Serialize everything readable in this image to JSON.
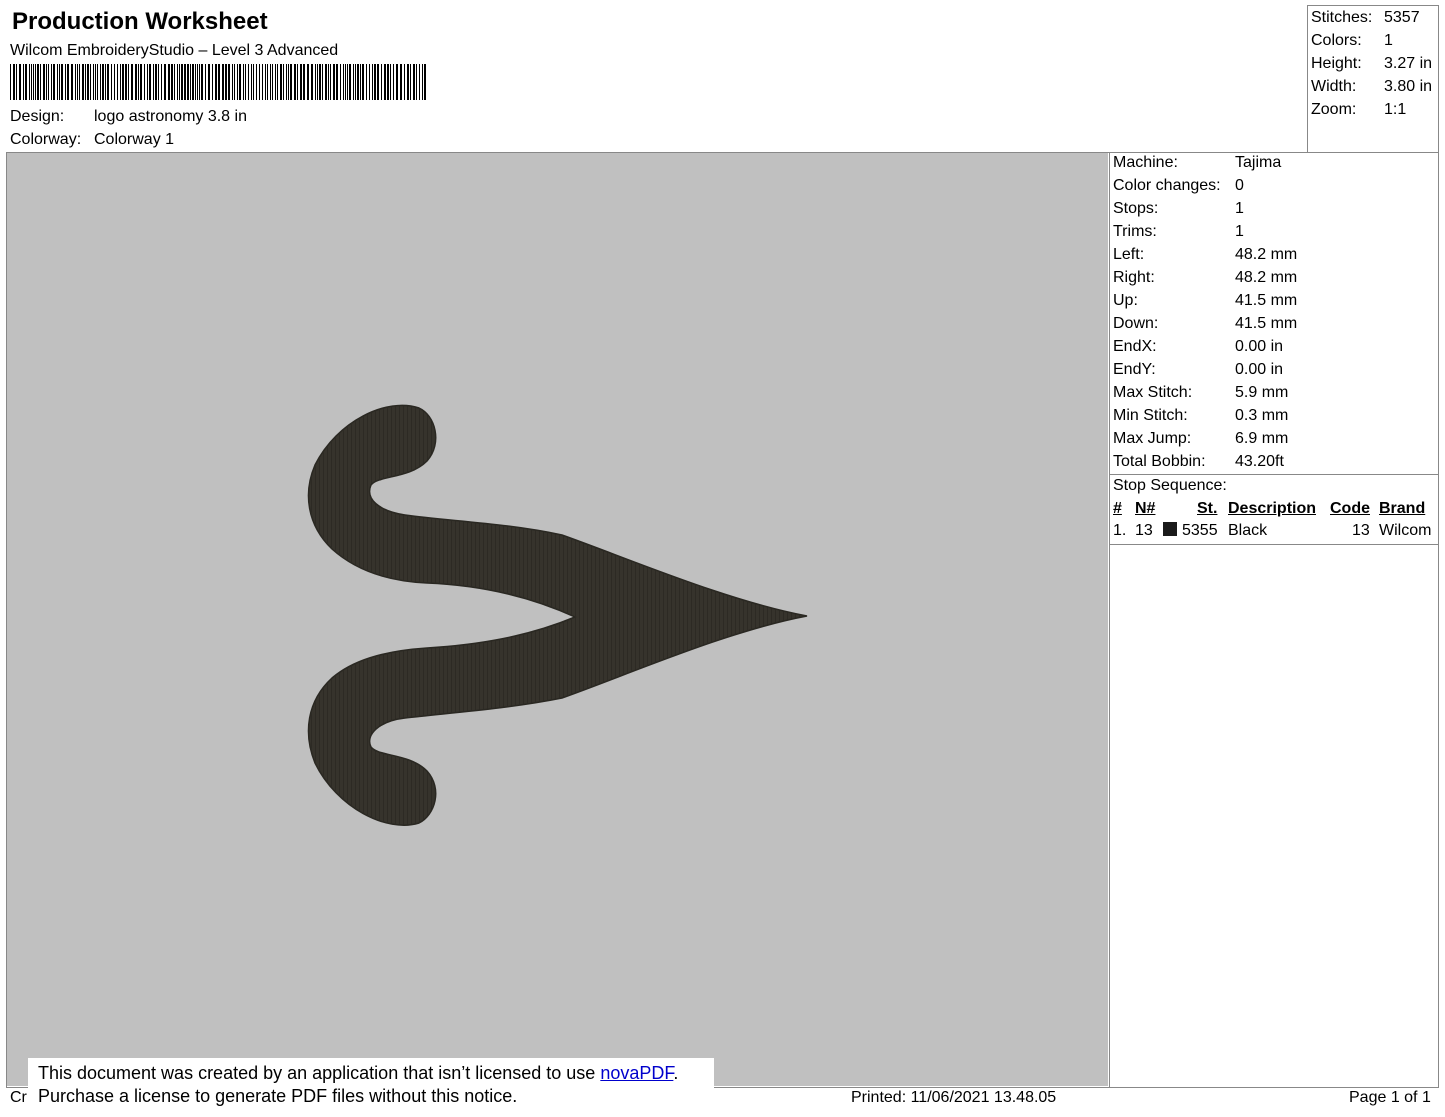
{
  "header": {
    "title": "Production Worksheet",
    "software": "Wilcom EmbroideryStudio – Level 3 Advanced",
    "design_label": "Design:",
    "design_value": "logo astronomy 3.8 in",
    "colorway_label": "Colorway:",
    "colorway_value": "Colorway 1"
  },
  "summary": {
    "stitches_label": "Stitches:",
    "stitches_value": "5357",
    "colors_label": "Colors:",
    "colors_value": "1",
    "height_label": "Height:",
    "height_value": "3.27 in",
    "width_label": "Width:",
    "width_value": "3.80 in",
    "zoom_label": "Zoom:",
    "zoom_value": "1:1"
  },
  "details": [
    {
      "label": "Machine:",
      "value": "Tajima"
    },
    {
      "label": "Color changes:",
      "value": "0"
    },
    {
      "label": "Stops:",
      "value": "1"
    },
    {
      "label": "Trims:",
      "value": "1"
    },
    {
      "label": "Left:",
      "value": "48.2 mm"
    },
    {
      "label": "Right:",
      "value": "48.2 mm"
    },
    {
      "label": "Up:",
      "value": "41.5 mm"
    },
    {
      "label": "Down:",
      "value": "41.5 mm"
    },
    {
      "label": "EndX:",
      "value": "0.00 in"
    },
    {
      "label": "EndY:",
      "value": "0.00 in"
    },
    {
      "label": "Max Stitch:",
      "value": "5.9 mm"
    },
    {
      "label": "Min Stitch:",
      "value": "0.3 mm"
    },
    {
      "label": "Max Jump:",
      "value": "6.9 mm"
    },
    {
      "label": "Total Bobbin:",
      "value": "43.20ft"
    }
  ],
  "stop_sequence": {
    "title": "Stop Sequence:",
    "headers": {
      "num": "#",
      "n": "N#",
      "st": "St.",
      "description": "Description",
      "code": "Code",
      "brand": "Brand"
    },
    "rows": [
      {
        "num": "1.",
        "n": "13",
        "swatch_color": "#1a1a1a",
        "st": "5355",
        "description": "Black",
        "code": "13",
        "brand": "Wilcom"
      }
    ]
  },
  "design": {
    "background_color": "#c0c0c0",
    "thread_color": "#36332c"
  },
  "notice": {
    "line1_prefix": "This document was created by an application that isn’t licensed to use ",
    "line1_link": "novaPDF",
    "line1_suffix": ".",
    "line2": "Purchase a license to generate PDF files without this notice."
  },
  "footer": {
    "left_fragment": "Cr",
    "printed": "Printed: 11/06/2021 13.48.05",
    "page": "Page 1 of 1"
  }
}
